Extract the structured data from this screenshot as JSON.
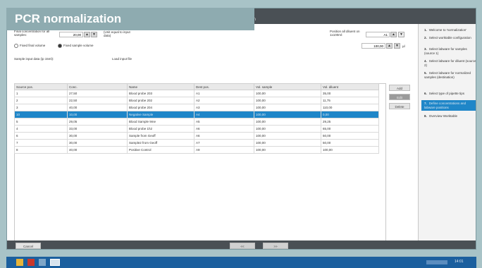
{
  "overlay_title": "PCR normalization",
  "window_title_suffix": "ation",
  "top": {
    "final_conc_label": "Final concentration for all samples:",
    "final_conc_value": "20,00",
    "unit_label": "(Unit equal to input data)",
    "position_label": "Position all diluent on 1x100ml:",
    "position_value": "A1",
    "radio_fixed_final": "Fixed final volume",
    "radio_fixed_sample": "Fixed sample volume",
    "sample_volume_value": "100,00",
    "volume_unit": "µl",
    "sample_input_label": "Sample input data (ip 15ml):",
    "load_input_label": "Load input file"
  },
  "table": {
    "headers": [
      "Source pos.",
      "Conc.",
      "Name",
      "Dest pos.",
      "Vol. sample",
      "Vol. diluent"
    ],
    "rows": [
      [
        "1",
        "27,50",
        "Blood probe 203",
        "A1",
        "100,00",
        "35,00"
      ],
      [
        "2",
        "22,50",
        "Blood probe 202",
        "A2",
        "100,00",
        "11,75"
      ],
      [
        "3",
        "40,00",
        "Blood probe 204",
        "A3",
        "100,00",
        "110,00"
      ],
      [
        "10",
        "10,00",
        "Negative Sample",
        "A4",
        "100,00",
        "0,00"
      ],
      [
        "5",
        "29,05",
        "Blood Sample 9me",
        "A5",
        "100,00",
        "29,25"
      ],
      [
        "4",
        "33,00",
        "Blood probe 1h2",
        "A6",
        "100,00",
        "65,00"
      ],
      [
        "6",
        "30,00",
        "Sample from Geoff",
        "A6",
        "100,00",
        "50,00"
      ],
      [
        "7",
        "30,00",
        "Sample2 from Geoff",
        "A7",
        "100,00",
        "50,00"
      ],
      [
        "8",
        "40,00",
        "Positive Control",
        "A9",
        "100,00",
        "100,00"
      ]
    ],
    "selected_index": 3
  },
  "side_buttons": {
    "add": "Add",
    "edit": "Edit",
    "delete": "Delete"
  },
  "steps": [
    {
      "n": "1.",
      "label": "Welcome to 'normalization'"
    },
    {
      "n": "2.",
      "label": "Select worktable configuration"
    },
    {
      "n": "3.",
      "label": "Select labware for samples (source 1)"
    },
    {
      "n": "4.",
      "label": "Select labware for diluent (source 2)"
    },
    {
      "n": "5.",
      "label": "Select labware for normalized samples (destination)"
    },
    {
      "n": "6.",
      "label": "Select type of pipette tips"
    },
    {
      "n": "7.",
      "label": "Define concentrations and labware positions"
    },
    {
      "n": "8.",
      "label": "Overview Worktable"
    }
  ],
  "active_step": 6,
  "bottom": {
    "cancel": "Cancel",
    "back": "<<",
    "next": ">>"
  },
  "taskbar": {
    "clock": "14:01"
  }
}
